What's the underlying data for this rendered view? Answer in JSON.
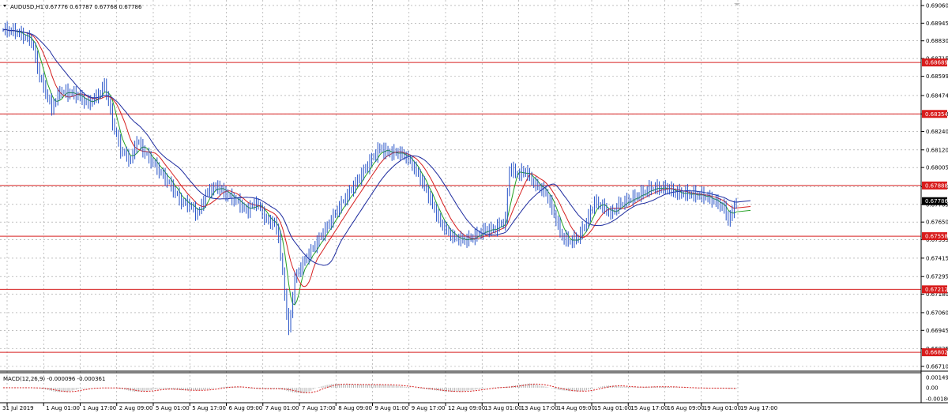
{
  "header": {
    "symbol_label": "AUDUSD,H1",
    "ohlc_text": "0.67776 0.67787 0.67768 0.67786"
  },
  "macd": {
    "label": "MACD(12,26,9) -0.000096 -0.000361",
    "scale_labels": [
      "0.001495",
      "0.00",
      "-0.001808"
    ]
  },
  "colors": {
    "background": "#ffffff",
    "grid": "#9a9a9a",
    "candles": "#2451c7",
    "ma_fast": "#22a022",
    "ma_mid": "#d62020",
    "ma_slow": "#1c2a9e",
    "level_lines": "#d62020",
    "level_box": "#d81c1c",
    "current_price_box": "#000000",
    "macd_hist": "#b0b0b0",
    "macd_signal": "#d62020"
  },
  "chart_data": {
    "type": "candlestick",
    "symbol": "AUDUSD",
    "timeframe": "H1",
    "ylim": [
      0.6671,
      0.69065
    ],
    "price_axis_labels": [
      "0.69060",
      "0.68945",
      "0.68830",
      "0.68715",
      "0.68599",
      "0.68474",
      "0.68354",
      "0.68240",
      "0.68120",
      "0.68005",
      "0.67880",
      "0.67765",
      "0.67650",
      "0.67535",
      "0.67415",
      "0.67295",
      "0.67180",
      "0.67060",
      "0.66945",
      "0.66825",
      "0.66710"
    ],
    "horizontal_levels": [
      "0.68689",
      "0.68354",
      "0.67888",
      "0.67558",
      "0.67212",
      "0.66802"
    ],
    "current_price": "0.67786",
    "x_labels": [
      "31 Jul 2019",
      "1 Aug 01:00",
      "1 Aug 17:00",
      "2 Aug 09:00",
      "5 Aug 01:00",
      "5 Aug 17:00",
      "6 Aug 09:00",
      "7 Aug 01:00",
      "7 Aug 17:00",
      "8 Aug 09:00",
      "9 Aug 01:00",
      "9 Aug 17:00",
      "12 Aug 09:00",
      "13 Aug 01:00",
      "13 Aug 17:00",
      "14 Aug 09:00",
      "15 Aug 01:00",
      "15 Aug 17:00",
      "16 Aug 09:00",
      "19 Aug 01:00",
      "19 Aug 17:00"
    ],
    "price_path": [
      [
        0,
        0.689
      ],
      [
        6,
        0.6889
      ],
      [
        14,
        0.6883
      ],
      [
        18,
        0.686
      ],
      [
        24,
        0.6839
      ],
      [
        28,
        0.685
      ],
      [
        36,
        0.6848
      ],
      [
        42,
        0.6842
      ],
      [
        48,
        0.6849
      ],
      [
        50,
        0.6855
      ],
      [
        54,
        0.683
      ],
      [
        58,
        0.6812
      ],
      [
        63,
        0.6805
      ],
      [
        66,
        0.6818
      ],
      [
        70,
        0.681
      ],
      [
        76,
        0.68
      ],
      [
        82,
        0.679
      ],
      [
        88,
        0.6778
      ],
      [
        92,
        0.6776
      ],
      [
        96,
        0.677
      ],
      [
        101,
        0.6785
      ],
      [
        106,
        0.6788
      ],
      [
        110,
        0.6783
      ],
      [
        116,
        0.6778
      ],
      [
        120,
        0.6772
      ],
      [
        125,
        0.6778
      ],
      [
        130,
        0.6766
      ],
      [
        134,
        0.6764
      ],
      [
        136,
        0.6756
      ],
      [
        139,
        0.6718
      ],
      [
        141,
        0.6694
      ],
      [
        144,
        0.6728
      ],
      [
        148,
        0.6738
      ],
      [
        154,
        0.675
      ],
      [
        160,
        0.6762
      ],
      [
        166,
        0.6775
      ],
      [
        174,
        0.679
      ],
      [
        182,
        0.6806
      ],
      [
        186,
        0.6813
      ],
      [
        190,
        0.681
      ],
      [
        196,
        0.681
      ],
      [
        200,
        0.6806
      ],
      [
        204,
        0.6798
      ],
      [
        208,
        0.6788
      ],
      [
        212,
        0.6776
      ],
      [
        216,
        0.6764
      ],
      [
        222,
        0.6755
      ],
      [
        228,
        0.6753
      ],
      [
        232,
        0.6755
      ],
      [
        238,
        0.676
      ],
      [
        242,
        0.676
      ],
      [
        248,
        0.6766
      ],
      [
        250,
        0.68
      ],
      [
        254,
        0.6796
      ],
      [
        258,
        0.6798
      ],
      [
        262,
        0.679
      ],
      [
        268,
        0.6784
      ],
      [
        272,
        0.677
      ],
      [
        276,
        0.6755
      ],
      [
        280,
        0.6752
      ],
      [
        284,
        0.6755
      ],
      [
        288,
        0.6765
      ],
      [
        292,
        0.6778
      ],
      [
        296,
        0.6775
      ],
      [
        300,
        0.677
      ],
      [
        304,
        0.6776
      ],
      [
        310,
        0.678
      ],
      [
        316,
        0.6784
      ],
      [
        320,
        0.6787
      ],
      [
        328,
        0.6787
      ],
      [
        332,
        0.6784
      ],
      [
        340,
        0.6783
      ],
      [
        346,
        0.6782
      ],
      [
        352,
        0.6778
      ],
      [
        356,
        0.6774
      ],
      [
        358,
        0.6766
      ],
      [
        360,
        0.6771
      ],
      [
        362,
        0.678
      ]
    ]
  }
}
